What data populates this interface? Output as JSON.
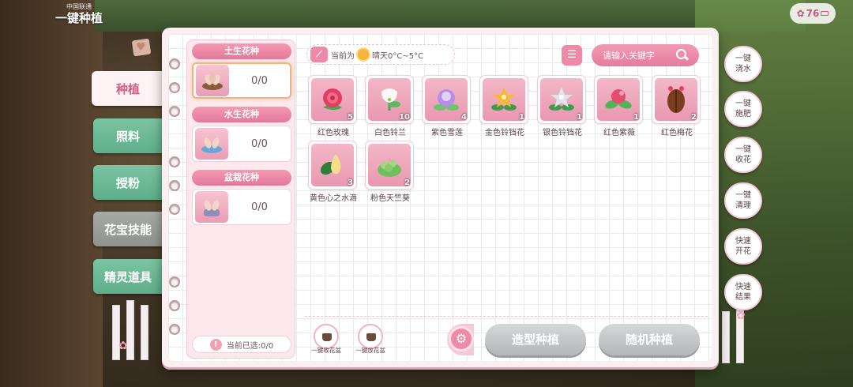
{
  "title": {
    "sub": "中国联通",
    "main": "一键种植"
  },
  "status": {
    "battery": "76"
  },
  "tabs": [
    {
      "label": "种植",
      "state": "active"
    },
    {
      "label": "照料",
      "state": "green"
    },
    {
      "label": "授粉",
      "state": "green"
    },
    {
      "label": "花宝技能",
      "state": "grey"
    },
    {
      "label": "精灵道具",
      "state": "green"
    }
  ],
  "seed_categories": [
    {
      "header": "土生花种",
      "count": "0/0"
    },
    {
      "header": "水生花种",
      "count": "0/0"
    },
    {
      "header": "盆栽花种",
      "count": "0/0"
    }
  ],
  "selected_status": "当前已选:0/0",
  "weather": {
    "prefix": "当前为",
    "text": "晴天0°C~5°C"
  },
  "search": {
    "placeholder": "请输入关键字"
  },
  "flowers": [
    {
      "name": "红色玫瑰",
      "qty": "5",
      "icon": "red-rose-icon"
    },
    {
      "name": "白色铃兰",
      "qty": "10",
      "icon": "white-lily-of-valley-icon"
    },
    {
      "name": "紫色雪莲",
      "qty": "4",
      "icon": "purple-snow-lotus-icon"
    },
    {
      "name": "金色铃铛花",
      "qty": "1",
      "icon": "golden-bell-flower-icon"
    },
    {
      "name": "银色铃铛花",
      "qty": "1",
      "icon": "silver-bell-flower-icon"
    },
    {
      "name": "红色紫薇",
      "qty": "1",
      "icon": "red-crape-myrtle-icon"
    },
    {
      "name": "红色梅花",
      "qty": "2",
      "icon": "red-plum-blossom-icon"
    },
    {
      "name": "黄色心之水滴",
      "qty": "3",
      "icon": "yellow-heart-droplet-icon"
    },
    {
      "name": "粉色天竺葵",
      "qty": "2",
      "icon": "pink-geranium-icon"
    }
  ],
  "pot_buttons": [
    {
      "label": "一键收花盆"
    },
    {
      "label": "一键放花盆"
    }
  ],
  "actions": {
    "shape_plant": "造型种植",
    "random_plant": "随机种植"
  },
  "quick_actions": [
    {
      "label": "一键浇水"
    },
    {
      "label": "一键施肥"
    },
    {
      "label": "一键收花"
    },
    {
      "label": "一键清理"
    },
    {
      "label": "快速开花"
    },
    {
      "label": "快速结果"
    }
  ],
  "colors": {
    "accent": "#ee8aa8",
    "panel": "#fbeff2",
    "tab_green": "#6cb994",
    "tab_grey": "#9c9f9a"
  }
}
